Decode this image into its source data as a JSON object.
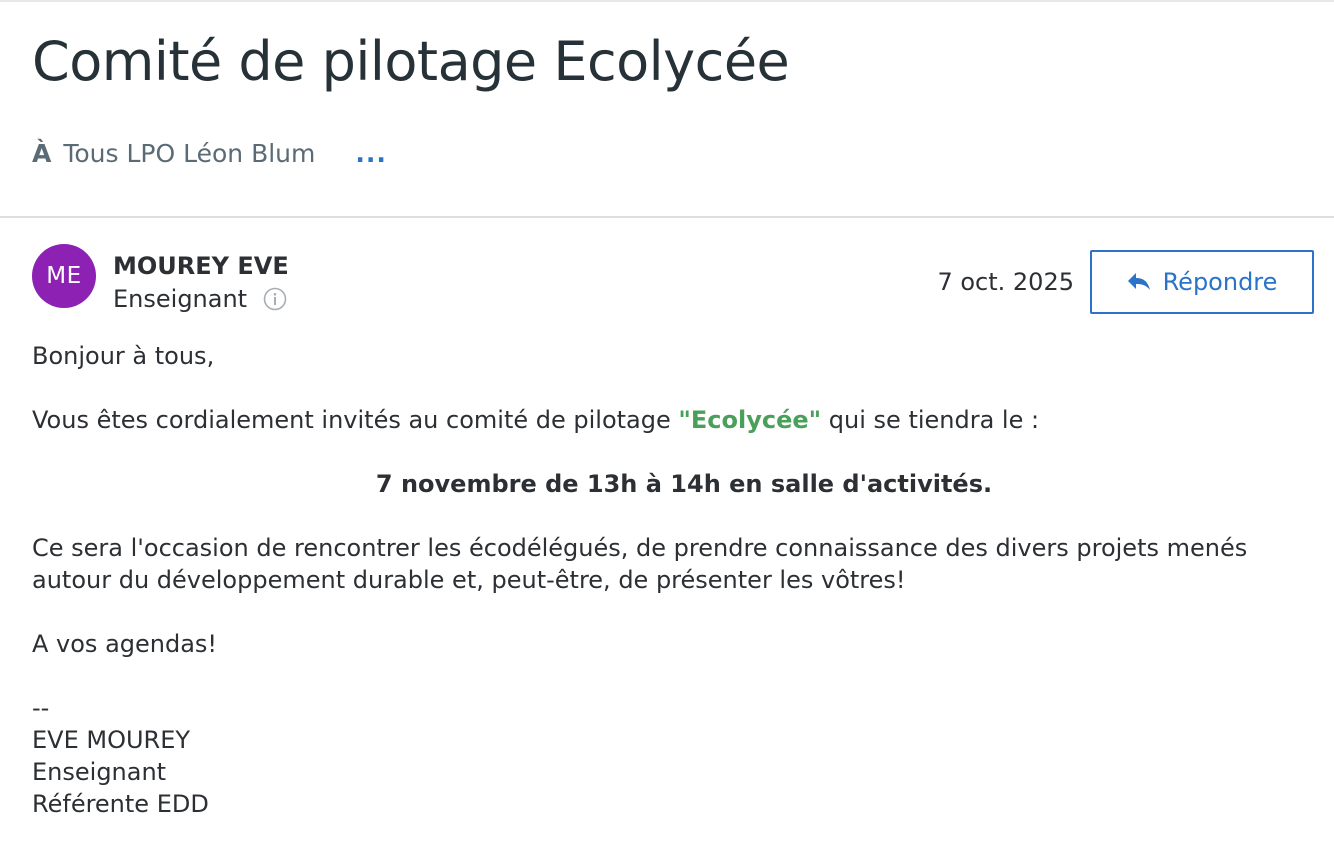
{
  "message": {
    "subject": "Comité de pilotage Ecolycée",
    "to_label": "À",
    "recipients": "Tous LPO Léon Blum",
    "more_recipients": "...",
    "sender": {
      "initials": "ME",
      "name": "MOUREY EVE",
      "role": "Enseignant",
      "avatar_color": "#8c21b3"
    },
    "date": "7 oct. 2025",
    "reply_label": "Répondre",
    "body": {
      "greeting": "Bonjour à tous,",
      "intro_before": "Vous êtes cordialement invités au comité de pilotage ",
      "intro_highlight": "\"Ecolycée\"",
      "intro_after": " qui se tiendra le :",
      "event": "7 novembre de 13h à 14h en salle d'activités.",
      "paragraph_line1": "Ce sera l'occasion de rencontrer les écodélégués, de prendre connaissance des divers projets menés",
      "paragraph_line2": "autour du développement durable et, peut-être, de présenter les vôtres!",
      "closing": "A vos agendas!",
      "signature_sep": "--",
      "signature_name": "EVE MOUREY",
      "signature_role": "Enseignant",
      "signature_title": "Référente EDD"
    }
  },
  "colors": {
    "accent": "#2a73c9",
    "highlight": "#4aa05a",
    "text": "#2c2f33"
  },
  "icons": [
    "info-icon",
    "reply-icon"
  ]
}
